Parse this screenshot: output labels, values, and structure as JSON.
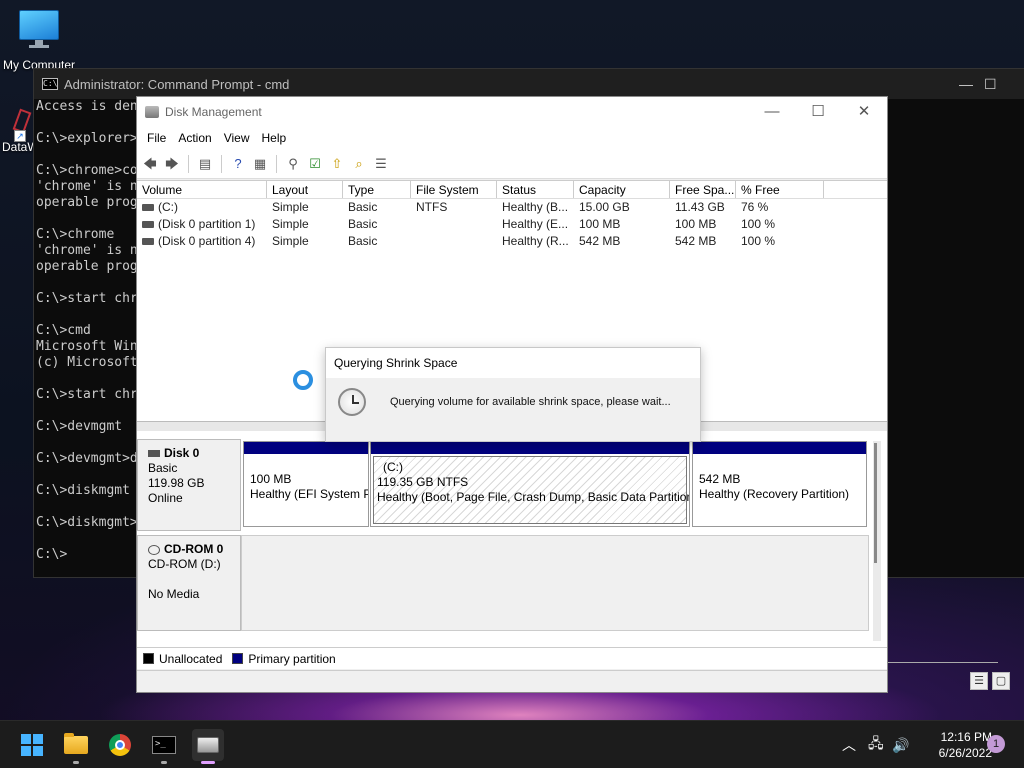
{
  "desktop": {
    "icons": [
      {
        "label": "My Computer"
      },
      {
        "label": "DataW"
      }
    ]
  },
  "cmd": {
    "title": "Administrator: Command Prompt - cmd",
    "lines": [
      "Access is den",
      "",
      "C:\\>explorer>",
      "",
      "C:\\>chrome>co",
      "'chrome' is n",
      "operable prog",
      "",
      "C:\\>chrome",
      "'chrome' is n",
      "operable prog",
      "",
      "C:\\>start chr",
      "",
      "C:\\>cmd",
      "Microsoft Win",
      "(c) Microsoft",
      "",
      "C:\\>start chr",
      "",
      "C:\\>devmgmt",
      "",
      "C:\\>devmgmt>d",
      "",
      "C:\\>diskmgmt",
      "",
      "C:\\>diskmgmt>",
      "",
      "C:\\>"
    ]
  },
  "diskmgmt": {
    "title": "Disk Management",
    "menu": [
      "File",
      "Action",
      "View",
      "Help"
    ],
    "columns": [
      "Volume",
      "Layout",
      "Type",
      "File System",
      "Status",
      "Capacity",
      "Free Spa...",
      "% Free"
    ],
    "rows": [
      {
        "volume": "(C:)",
        "layout": "Simple",
        "type": "Basic",
        "fs": "NTFS",
        "status": "Healthy (B...",
        "capacity": "15.00 GB",
        "free": "11.43 GB",
        "pct": "76 %"
      },
      {
        "volume": "(Disk 0 partition 1)",
        "layout": "Simple",
        "type": "Basic",
        "fs": "",
        "status": "Healthy (E...",
        "capacity": "100 MB",
        "free": "100 MB",
        "pct": "100 %"
      },
      {
        "volume": "(Disk 0 partition 4)",
        "layout": "Simple",
        "type": "Basic",
        "fs": "",
        "status": "Healthy (R...",
        "capacity": "542 MB",
        "free": "542 MB",
        "pct": "100 %"
      }
    ],
    "disk0": {
      "name": "Disk 0",
      "type": "Basic",
      "size": "119.98 GB",
      "state": "Online"
    },
    "partitions": [
      {
        "label": "",
        "size": "100 MB",
        "status": "Healthy (EFI System P"
      },
      {
        "label": "(C:)",
        "size": "119.35 GB NTFS",
        "status": "Healthy (Boot, Page File, Crash Dump, Basic Data Partition"
      },
      {
        "label": "",
        "size": "542 MB",
        "status": "Healthy (Recovery Partition)"
      }
    ],
    "cdrom": {
      "name": "CD-ROM 0",
      "type": "CD-ROM (D:)",
      "media": "No Media"
    },
    "legend": {
      "unallocated": "Unallocated",
      "primary": "Primary partition",
      "unallocated_color": "#000000",
      "primary_color": "#00007f"
    }
  },
  "dialog": {
    "title": "Querying Shrink Space",
    "message": "Querying volume for available shrink space, please wait..."
  },
  "taskbar": {
    "time": "12:16 PM",
    "date": "6/26/2022",
    "notifications": "1"
  }
}
